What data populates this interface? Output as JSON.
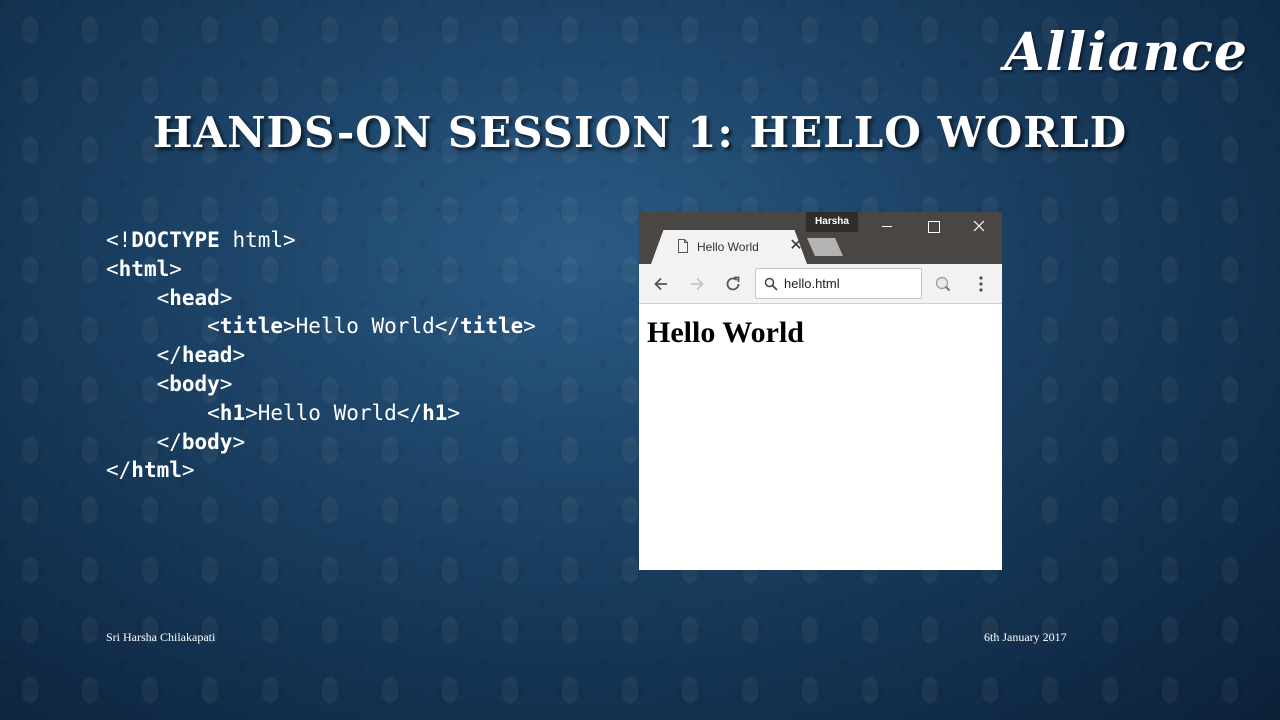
{
  "slide": {
    "logo": "Alliance",
    "title": "HANDS-ON SESSION 1: HELLO WORLD",
    "code_lines": [
      [
        "<!",
        {
          "b": "DOCTYPE"
        },
        " html>"
      ],
      [
        "<",
        {
          "b": "html"
        },
        ">"
      ],
      [
        "    <",
        {
          "b": "head"
        },
        ">"
      ],
      [
        "        <",
        {
          "b": "title"
        },
        ">Hello World</",
        {
          "b": "title"
        },
        ">"
      ],
      [
        "    </",
        {
          "b": "head"
        },
        ">"
      ],
      [
        "    <",
        {
          "b": "body"
        },
        ">"
      ],
      [
        "        <",
        {
          "b": "h1"
        },
        ">Hello World</",
        {
          "b": "h1"
        },
        ">"
      ],
      [
        "    </",
        {
          "b": "body"
        },
        ">"
      ],
      [
        "</",
        {
          "b": "html"
        },
        ">"
      ]
    ],
    "footer_left": "Sri Harsha Chilakapati",
    "footer_right": "6th January 2017"
  },
  "browser": {
    "profile_name": "Harsha",
    "tab_title": "Hello World",
    "tab_close": "✕",
    "address": "hello.html",
    "page_heading": "Hello World"
  },
  "colors": {
    "background": "#1d4468",
    "titlebar": "#4a4644",
    "toolbar": "#f2f2f2"
  }
}
